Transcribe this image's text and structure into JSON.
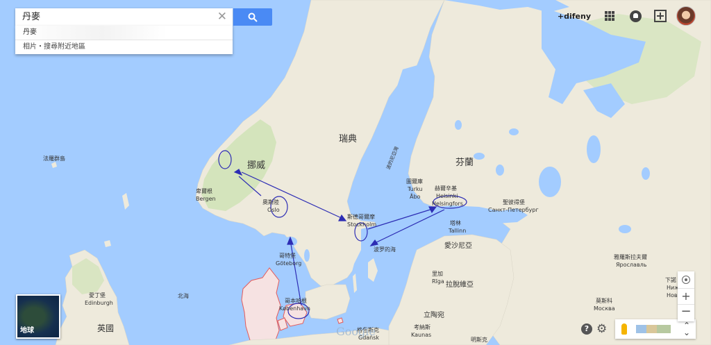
{
  "search": {
    "query": "丹麥",
    "suggestions": [
      "丹麥",
      "相片・搜尋附近地區"
    ]
  },
  "header": {
    "user_link": "+difeny"
  },
  "map": {
    "labels": {
      "finland": "芬蘭",
      "norway": "挪威",
      "sweden": "瑞典",
      "faroe": "法羅群島",
      "bergen_zh": "卑爾根",
      "bergen": "Bergen",
      "oslo_zh": "奧斯陸",
      "oslo": "Oslo",
      "stockholm_zh": "斯德哥爾摩",
      "stockholm": "Stockholm",
      "goteborg_zh": "哥特堡",
      "goteborg": "Göteborg",
      "copenhagen_zh": "哥本哈根",
      "copenhagen": "København",
      "turku_zh": "圖爾庫",
      "turku": "Turku",
      "abo": "Åbo",
      "helsinki_zh": "赫爾辛基",
      "helsinki": "Helsinki",
      "helsingfors": "Helsingfors",
      "tallinn_zh": "塔林",
      "tallinn": "Tallinn",
      "estonia": "愛沙尼亞",
      "riga_zh": "里加",
      "riga": "Rīga",
      "latvia": "拉脫維亞",
      "lithuania": "立陶宛",
      "kaunas_zh": "考納斯",
      "kaunas": "Kaunas",
      "spb_zh": "聖彼得堡",
      "spb": "Санкт-Петербург",
      "yaroslavl_zh": "雅羅斯拉夫爾",
      "yaroslavl": "Ярославль",
      "moscow_zh": "莫斯科",
      "moscow": "Москва",
      "nizhny_zh": "下諾",
      "nizhny": "Нижн",
      "nizhny2": "Новг",
      "edinburgh_zh": "愛丁堡",
      "edinburgh": "Edinburgh",
      "uk": "英國",
      "north_sea": "北海",
      "baltic_sea": "波罗的海",
      "gulf_bothnia": "波的尼亞灣",
      "gdansk_zh": "格但斯克",
      "gdansk": "Gdańsk",
      "minsk_zh": "明斯克"
    }
  },
  "controls": {
    "earth_label": "地球",
    "help": "?",
    "zoom_in": "+",
    "zoom_out": "−",
    "google_logo": "Google"
  }
}
